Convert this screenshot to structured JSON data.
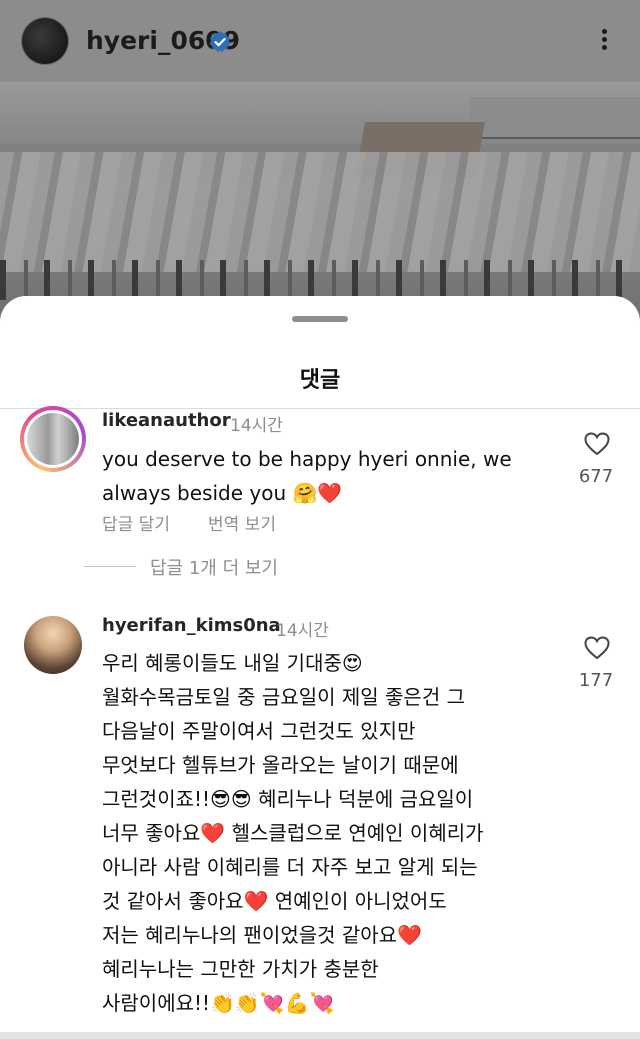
{
  "header": {
    "username": "hyeri_0609",
    "verified": true,
    "more_icon": "more-vertical-icon"
  },
  "sheet": {
    "title": "댓글"
  },
  "comments": [
    {
      "username": "likeanauthor",
      "time": "14시간",
      "text_lines": [
        "you deserve to be happy hyeri onnie, we",
        "always beside you 🤗❤️"
      ],
      "reply_label": "답글 달기",
      "translate_label": "번역 보기",
      "likes": "677",
      "view_replies": "답글 1개 더 보기"
    },
    {
      "username": "hyerifan_kims0na",
      "time": "14시간",
      "text_lines": [
        "우리 혜롱이들도 내일 기대중😍",
        "월화수목금토일 중 금요일이 제일 좋은건 그",
        "다음날이 주말이여서 그런것도 있지만",
        "무엇보다 헬튜브가 올라오는 날이기 때문에",
        "그런것이죠!!😎😎 혜리누나 덕분에 금요일이",
        "너무 좋아요❤️ 헬스클럽으로 연예인 이혜리가",
        "아니라 사람 이혜리를 더 자주 보고 알게 되는",
        "것 같아서 좋아요❤️ 연예인이 아니었어도",
        "저는 혜리누나의 팬이었을것 같아요❤️",
        "혜리누나는 그만한 가치가 충분한",
        "사람이에요!!👏👏💘💪💘"
      ],
      "likes": "177"
    }
  ],
  "colors": {
    "muted_text": "#8e8e8e",
    "verified_blue": "#3897f0",
    "overlay": "#7a7a7a"
  }
}
